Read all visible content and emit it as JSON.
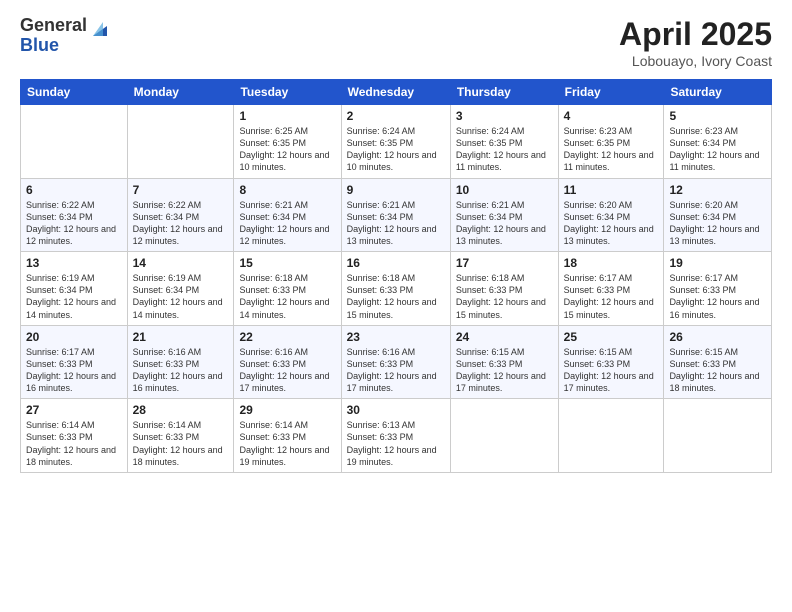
{
  "logo": {
    "general": "General",
    "blue": "Blue"
  },
  "title": {
    "month": "April 2025",
    "location": "Lobouayo, Ivory Coast"
  },
  "weekdays": [
    "Sunday",
    "Monday",
    "Tuesday",
    "Wednesday",
    "Thursday",
    "Friday",
    "Saturday"
  ],
  "weeks": [
    [
      {
        "day": "",
        "info": ""
      },
      {
        "day": "",
        "info": ""
      },
      {
        "day": "1",
        "info": "Sunrise: 6:25 AM\nSunset: 6:35 PM\nDaylight: 12 hours and 10 minutes."
      },
      {
        "day": "2",
        "info": "Sunrise: 6:24 AM\nSunset: 6:35 PM\nDaylight: 12 hours and 10 minutes."
      },
      {
        "day": "3",
        "info": "Sunrise: 6:24 AM\nSunset: 6:35 PM\nDaylight: 12 hours and 11 minutes."
      },
      {
        "day": "4",
        "info": "Sunrise: 6:23 AM\nSunset: 6:35 PM\nDaylight: 12 hours and 11 minutes."
      },
      {
        "day": "5",
        "info": "Sunrise: 6:23 AM\nSunset: 6:34 PM\nDaylight: 12 hours and 11 minutes."
      }
    ],
    [
      {
        "day": "6",
        "info": "Sunrise: 6:22 AM\nSunset: 6:34 PM\nDaylight: 12 hours and 12 minutes."
      },
      {
        "day": "7",
        "info": "Sunrise: 6:22 AM\nSunset: 6:34 PM\nDaylight: 12 hours and 12 minutes."
      },
      {
        "day": "8",
        "info": "Sunrise: 6:21 AM\nSunset: 6:34 PM\nDaylight: 12 hours and 12 minutes."
      },
      {
        "day": "9",
        "info": "Sunrise: 6:21 AM\nSunset: 6:34 PM\nDaylight: 12 hours and 13 minutes."
      },
      {
        "day": "10",
        "info": "Sunrise: 6:21 AM\nSunset: 6:34 PM\nDaylight: 12 hours and 13 minutes."
      },
      {
        "day": "11",
        "info": "Sunrise: 6:20 AM\nSunset: 6:34 PM\nDaylight: 12 hours and 13 minutes."
      },
      {
        "day": "12",
        "info": "Sunrise: 6:20 AM\nSunset: 6:34 PM\nDaylight: 12 hours and 13 minutes."
      }
    ],
    [
      {
        "day": "13",
        "info": "Sunrise: 6:19 AM\nSunset: 6:34 PM\nDaylight: 12 hours and 14 minutes."
      },
      {
        "day": "14",
        "info": "Sunrise: 6:19 AM\nSunset: 6:34 PM\nDaylight: 12 hours and 14 minutes."
      },
      {
        "day": "15",
        "info": "Sunrise: 6:18 AM\nSunset: 6:33 PM\nDaylight: 12 hours and 14 minutes."
      },
      {
        "day": "16",
        "info": "Sunrise: 6:18 AM\nSunset: 6:33 PM\nDaylight: 12 hours and 15 minutes."
      },
      {
        "day": "17",
        "info": "Sunrise: 6:18 AM\nSunset: 6:33 PM\nDaylight: 12 hours and 15 minutes."
      },
      {
        "day": "18",
        "info": "Sunrise: 6:17 AM\nSunset: 6:33 PM\nDaylight: 12 hours and 15 minutes."
      },
      {
        "day": "19",
        "info": "Sunrise: 6:17 AM\nSunset: 6:33 PM\nDaylight: 12 hours and 16 minutes."
      }
    ],
    [
      {
        "day": "20",
        "info": "Sunrise: 6:17 AM\nSunset: 6:33 PM\nDaylight: 12 hours and 16 minutes."
      },
      {
        "day": "21",
        "info": "Sunrise: 6:16 AM\nSunset: 6:33 PM\nDaylight: 12 hours and 16 minutes."
      },
      {
        "day": "22",
        "info": "Sunrise: 6:16 AM\nSunset: 6:33 PM\nDaylight: 12 hours and 17 minutes."
      },
      {
        "day": "23",
        "info": "Sunrise: 6:16 AM\nSunset: 6:33 PM\nDaylight: 12 hours and 17 minutes."
      },
      {
        "day": "24",
        "info": "Sunrise: 6:15 AM\nSunset: 6:33 PM\nDaylight: 12 hours and 17 minutes."
      },
      {
        "day": "25",
        "info": "Sunrise: 6:15 AM\nSunset: 6:33 PM\nDaylight: 12 hours and 17 minutes."
      },
      {
        "day": "26",
        "info": "Sunrise: 6:15 AM\nSunset: 6:33 PM\nDaylight: 12 hours and 18 minutes."
      }
    ],
    [
      {
        "day": "27",
        "info": "Sunrise: 6:14 AM\nSunset: 6:33 PM\nDaylight: 12 hours and 18 minutes."
      },
      {
        "day": "28",
        "info": "Sunrise: 6:14 AM\nSunset: 6:33 PM\nDaylight: 12 hours and 18 minutes."
      },
      {
        "day": "29",
        "info": "Sunrise: 6:14 AM\nSunset: 6:33 PM\nDaylight: 12 hours and 19 minutes."
      },
      {
        "day": "30",
        "info": "Sunrise: 6:13 AM\nSunset: 6:33 PM\nDaylight: 12 hours and 19 minutes."
      },
      {
        "day": "",
        "info": ""
      },
      {
        "day": "",
        "info": ""
      },
      {
        "day": "",
        "info": ""
      }
    ]
  ]
}
